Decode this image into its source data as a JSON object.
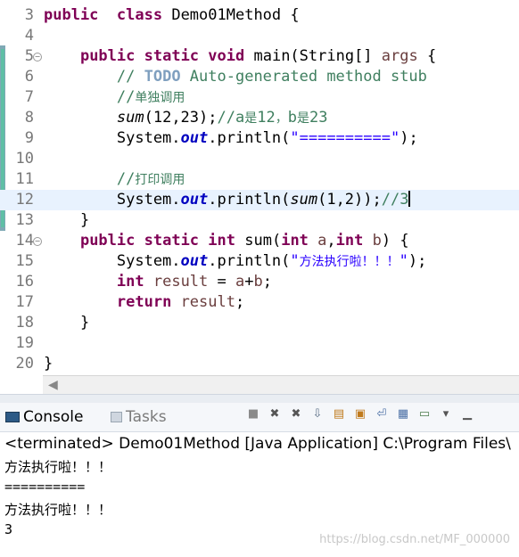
{
  "editor": {
    "lines": [
      {
        "num": "3",
        "parts": [
          [
            "kw",
            "public"
          ],
          [
            "",
            "  "
          ],
          [
            "kw",
            "class"
          ],
          [
            "",
            " Demo01Method {"
          ]
        ]
      },
      {
        "num": "4",
        "parts": []
      },
      {
        "num": "5",
        "parts": [
          [
            "",
            "    "
          ],
          [
            "kw",
            "public"
          ],
          [
            "",
            " "
          ],
          [
            "kw",
            "static"
          ],
          [
            "",
            " "
          ],
          [
            "kw",
            "void"
          ],
          [
            "",
            " main(String[] "
          ],
          [
            "var",
            "args"
          ],
          [
            "",
            " {"
          ]
        ]
      },
      {
        "num": "6",
        "parts": [
          [
            "",
            "        "
          ],
          [
            "cm",
            "// "
          ],
          [
            "todo",
            "TODO"
          ],
          [
            "cm",
            " Auto-generated method stub"
          ]
        ]
      },
      {
        "num": "7",
        "parts": [
          [
            "",
            "        "
          ],
          [
            "cm",
            "//单独调用"
          ]
        ]
      },
      {
        "num": "8",
        "parts": [
          [
            "",
            "        "
          ],
          [
            "it",
            "sum"
          ],
          [
            "",
            "(12,23);"
          ],
          [
            "cm",
            "//a是12，b是23"
          ]
        ]
      },
      {
        "num": "9",
        "parts": [
          [
            "",
            "        System."
          ],
          [
            "fld",
            "out"
          ],
          [
            "",
            ".println("
          ],
          [
            "str",
            "\"==========\""
          ],
          [
            "",
            ");"
          ]
        ]
      },
      {
        "num": "10",
        "parts": []
      },
      {
        "num": "11",
        "parts": [
          [
            "",
            "        "
          ],
          [
            "cm",
            "//打印调用"
          ]
        ]
      },
      {
        "num": "12",
        "parts": [
          [
            "",
            "        System."
          ],
          [
            "fld",
            "out"
          ],
          [
            "",
            ".println("
          ],
          [
            "it",
            "sum"
          ],
          [
            "",
            "(1,2));"
          ],
          [
            "cm",
            "//3"
          ],
          [
            "cur",
            ""
          ]
        ]
      },
      {
        "num": "13",
        "parts": [
          [
            "",
            "    }"
          ]
        ]
      },
      {
        "num": "14",
        "parts": [
          [
            "",
            "    "
          ],
          [
            "kw",
            "public"
          ],
          [
            "",
            " "
          ],
          [
            "kw",
            "static"
          ],
          [
            "",
            " "
          ],
          [
            "kw",
            "int"
          ],
          [
            "",
            " sum("
          ],
          [
            "kw",
            "int"
          ],
          [
            "",
            " "
          ],
          [
            "var",
            "a"
          ],
          [
            "",
            ","
          ],
          [
            "kw",
            "int"
          ],
          [
            "",
            " "
          ],
          [
            "var",
            "b"
          ],
          [
            "",
            ") {"
          ]
        ]
      },
      {
        "num": "15",
        "parts": [
          [
            "",
            "        System."
          ],
          [
            "fld",
            "out"
          ],
          [
            "",
            ".println("
          ],
          [
            "str",
            "\"方法执行啦！！！\""
          ],
          [
            "",
            ");"
          ]
        ]
      },
      {
        "num": "16",
        "parts": [
          [
            "",
            "        "
          ],
          [
            "kw",
            "int"
          ],
          [
            "",
            " "
          ],
          [
            "var",
            "result"
          ],
          [
            "",
            " = "
          ],
          [
            "var",
            "a"
          ],
          [
            "",
            "+"
          ],
          [
            "var",
            "b"
          ],
          [
            "",
            ";"
          ]
        ]
      },
      {
        "num": "17",
        "parts": [
          [
            "",
            "        "
          ],
          [
            "kw",
            "return"
          ],
          [
            "",
            " "
          ],
          [
            "var",
            "result"
          ],
          [
            "",
            ";"
          ]
        ]
      },
      {
        "num": "18",
        "parts": [
          [
            "",
            "    }"
          ]
        ]
      },
      {
        "num": "19",
        "parts": []
      },
      {
        "num": "20",
        "parts": [
          [
            "",
            "}"
          ]
        ]
      }
    ],
    "fold_icon": "minus-circle-icon",
    "current_line": "12"
  },
  "console": {
    "tab_label": "Console",
    "tasks_label": "Tasks",
    "terminated": "<terminated> Demo01Method [Java Application] C:\\Program Files\\",
    "output": [
      "方法执行啦！！！",
      "==========",
      "方法执行啦！！！",
      "3"
    ],
    "toolbar_icons": [
      "stop-icon",
      "remove-launch-icon",
      "remove-all-icon",
      "scroll-lock-icon",
      "clear-console-icon",
      "pin-console-icon",
      "word-wrap-icon",
      "display-selected-console-icon",
      "open-console-icon",
      "view-menu-icon",
      "minimize-icon"
    ]
  },
  "watermark": "https://blog.csdn.net/MF_000000"
}
